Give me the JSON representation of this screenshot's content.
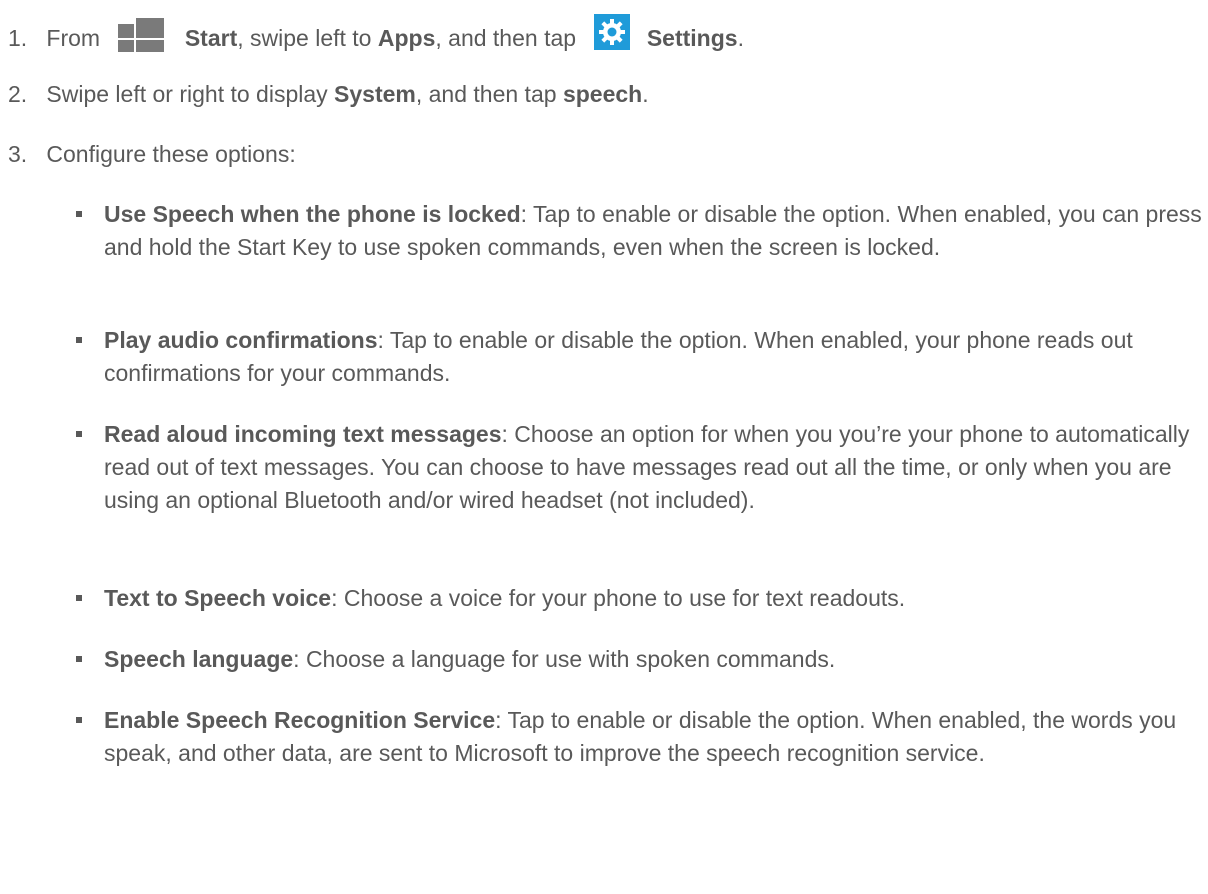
{
  "steps": [
    {
      "num": "1.",
      "t1": "From",
      "b1": "Start",
      "t2": ", swipe left to",
      "b2": "Apps",
      "t3": ", and then tap",
      "b3": "Settings",
      "t4": "."
    },
    {
      "num": "2.",
      "t1": "Swipe left or right to display",
      "b1": "System",
      "t2": ", and then tap",
      "b2": "speech",
      "t3": "."
    },
    {
      "num": "3.",
      "t1": "Configure these options:"
    }
  ],
  "options": [
    {
      "title": "Use Speech when the phone is locked",
      "desc": ": Tap to enable or disable the option. When enabled, you can press and hold the Start Key to use spoken commands, even when the screen is locked."
    },
    {
      "title": "Play audio confirmations",
      "desc": ": Tap to enable or disable the option. When enabled, your phone reads out confirmations for your commands."
    },
    {
      "title": "Read aloud incoming text messages",
      "desc": ": Choose an option for when you you’re your phone to automatically read out of text messages. You can choose to have messages read out all the time, or only when you are using an optional Bluetooth and/or wired headset (not included)."
    },
    {
      "title": "Text to Speech voice",
      "desc": ": Choose a voice for your phone to use for text readouts."
    },
    {
      "title": "Speech language",
      "desc": ": Choose a language for use with spoken commands."
    },
    {
      "title": "Enable Speech Recognition Service",
      "desc": ": Tap to enable or disable the option. When enabled, the words you speak, and other data, are sent to Microsoft to improve the speech recognition service."
    }
  ],
  "icons": {
    "start": "windows-start-icon",
    "settings": "gear-icon"
  },
  "colors": {
    "text": "#595959",
    "settings_tile": "#1f9bd9",
    "start_tiles": "#7a7a7a"
  }
}
